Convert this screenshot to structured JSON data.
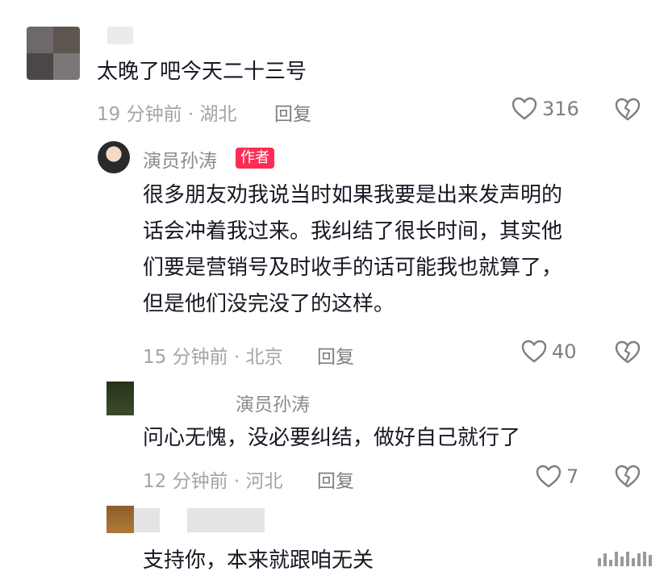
{
  "comments": [
    {
      "text": "太晚了吧今天二十三号",
      "meta": "19 分钟前 · 湖北",
      "reply_label": "回复",
      "likes": "316"
    },
    {
      "author": "演员孙涛",
      "badge": "作者",
      "paragraph": "很多朋友劝我说当时如果我要是出来发声明的话会冲着我过来。我纠结了很长时间，其实他们要是营销号及时收手的话可能我也就算了，但是他们没完没了的这样。",
      "lines": [
        "很多朋友劝我说当时如果我要是出来发声明的",
        "话会冲着我过来。我纠结了很长时间，其实他",
        "们要是营销号及时收手的话可能我也就算了，",
        "但是他们没完没了的这样。"
      ],
      "meta": "15 分钟前 · 北京",
      "reply_label": "回复",
      "likes": "40"
    },
    {
      "reply_to": "演员孙涛",
      "text": "问心无愧，没必要纠结，做好自己就行了",
      "meta": "12 分钟前 · 河北",
      "reply_label": "回复",
      "likes": "7"
    },
    {
      "text": "支持你，本来就跟咱无关"
    }
  ],
  "icons": {
    "like": "heart-outline-icon",
    "dislike": "broken-heart-icon"
  },
  "colors": {
    "badge": "#fe2c55",
    "meta": "#a4a4a8",
    "text": "#161823"
  }
}
